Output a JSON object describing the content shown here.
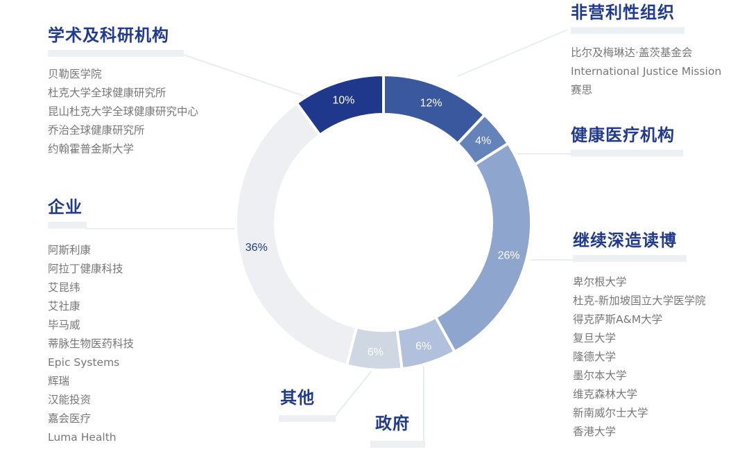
{
  "chart_data": {
    "type": "pie",
    "variant": "donut",
    "title": "",
    "start": "top",
    "direction": "clockwise",
    "slices": [
      {
        "category": "非营利性组织",
        "value": 12,
        "label": "12%",
        "color": "#3a589e",
        "label_color": "#ffffff"
      },
      {
        "category": "健康医疗机构",
        "value": 4,
        "label": "4%",
        "color": "#6583bb",
        "label_color": "#ffffff"
      },
      {
        "category": "继续深造读博",
        "value": 26,
        "label": "26%",
        "color": "#8ea5ce",
        "label_color": "#ffffff"
      },
      {
        "category": "政府",
        "value": 6,
        "label": "6%",
        "color": "#b0c0dd",
        "label_color": "#ffffff"
      },
      {
        "category": "其他",
        "value": 6,
        "label": "6%",
        "color": "#cfd7e3",
        "label_color": "#ffffff"
      },
      {
        "category": "企业",
        "value": 36,
        "label": "36%",
        "color": "#edeff2",
        "label_color": "#1f3a8f"
      },
      {
        "category": "学术及科研机构",
        "value": 10,
        "label": "10%",
        "color": "#1f388c",
        "label_color": "#ffffff"
      }
    ]
  },
  "groups": {
    "academic": {
      "title": "学术及科研机构",
      "items": [
        "贝勒医学院",
        "杜克大学全球健康研究所",
        "昆山杜克大学全球健康研究中心",
        "乔治全球健康研究所",
        "约翰霍普金斯大学"
      ]
    },
    "enterprise": {
      "title": "企业",
      "items": [
        "阿斯利康",
        "阿拉丁健康科技",
        "艾昆纬",
        "艾社康",
        "毕马威",
        "蒂脉生物医药科技",
        "Epic Systems",
        "辉瑞",
        "汉能投资",
        "嘉会医疗",
        "Luma Health"
      ]
    },
    "nonprofit": {
      "title": "非营利性组织",
      "items": [
        "比尔及梅琳达·盖茨基金会",
        "International Justice Mission",
        "赛思"
      ]
    },
    "healthcare": {
      "title": "健康医疗机构",
      "items": []
    },
    "phd": {
      "title": "继续深造读博",
      "items": [
        "卑尔根大学",
        "杜克-新加坡国立大学医学院",
        "得克萨斯A&M大学",
        "复旦大学",
        "隆德大学",
        "墨尔本大学",
        "维克森林大学",
        "新南威尔士大学",
        "香港大学"
      ]
    },
    "other": {
      "title": "其他",
      "items": []
    },
    "government": {
      "title": "政府",
      "items": []
    }
  }
}
